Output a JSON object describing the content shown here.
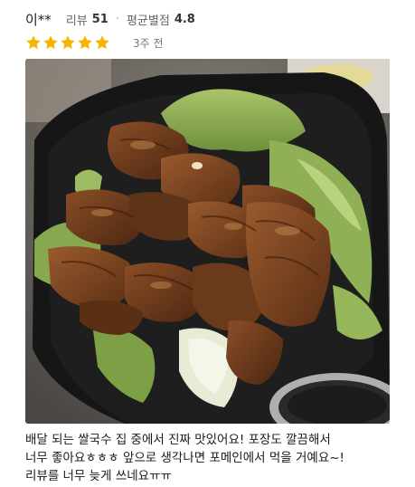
{
  "review": {
    "reviewer_name": "이**",
    "review_count_label": "리뷰",
    "review_count": "51",
    "separator": "·",
    "avg_rating_label": "평균별점",
    "avg_rating": "4.8",
    "stars": 5,
    "star_color": "#f7b500",
    "date": "3주 전",
    "photo": {
      "icon": "food-photo-image",
      "description_colors": {
        "container": "#151515",
        "lettuce": "#8aab52",
        "meat": "#6b3a1c"
      }
    },
    "text_lines": [
      "배달 되는 쌀국수 집 중에서 진짜 맛있어요! 포장도 깔끔해서",
      "너무 좋아요ㅎㅎㅎ 앞으로 생각나면 포메인에서 먹을 거예요~!",
      "리뷰를 너무 늦게 쓰네요ㅠㅠ"
    ]
  }
}
